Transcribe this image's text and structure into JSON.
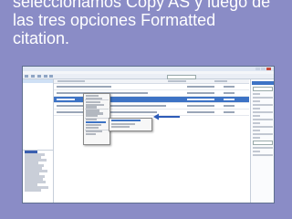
{
  "caption": {
    "line1": "seleccionamos Copy AS y luego de",
    "line2": "las tres opciones Formatted",
    "line3": "citation."
  },
  "accent_color": "#3d73c5",
  "arrow_color": "#2d5bb8"
}
